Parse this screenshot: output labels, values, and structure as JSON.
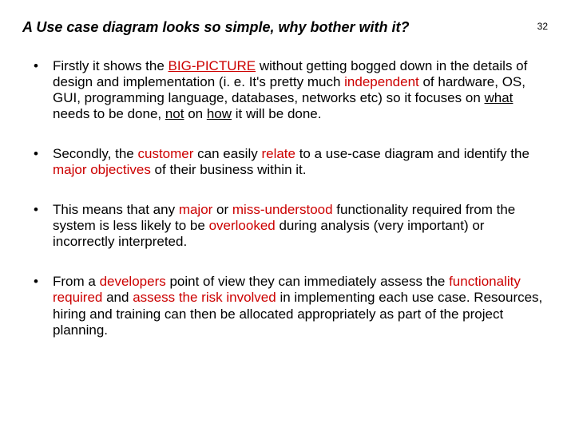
{
  "title": "A Use case diagram looks so simple, why bother with it?",
  "page_number": "32",
  "bullets": [
    {
      "p1a": "Firstly it shows the ",
      "p1b": "BIG-PICTURE",
      "p1c": " without getting bogged down in the details of design and implementation (i. e. It's pretty much ",
      "p1d": "independent",
      "p1e": " of hardware, OS, GUI, programming language, databases, networks etc) so it focuses on ",
      "p1f": "what",
      "p1g": " needs to be done, ",
      "p1h": "not",
      "p1i": " on ",
      "p1j": "how",
      "p1k": " it will be done."
    },
    {
      "p2a": "Secondly, the ",
      "p2b": "customer",
      "p2c": " can easily ",
      "p2d": "relate",
      "p2e": " to a use-case diagram and identify the ",
      "p2f": "major objectives",
      "p2g": " of their business within it."
    },
    {
      "p3a": "This means that any ",
      "p3b": "major",
      "p3c": " or ",
      "p3d": "miss-understood",
      "p3e": " functionality required from the system is less likely to be ",
      "p3f": "overlooked",
      "p3g": " during analysis (very important) or incorrectly interpreted."
    },
    {
      "p4a": "From a ",
      "p4b": "developers",
      "p4c": " point of view they can immediately assess the ",
      "p4d": "functionality required",
      "p4e": " and ",
      "p4f": "assess the risk involved",
      "p4g": " in implementing each use case. Resources, hiring and training can then be allocated appropriately as part of the project planning."
    }
  ]
}
